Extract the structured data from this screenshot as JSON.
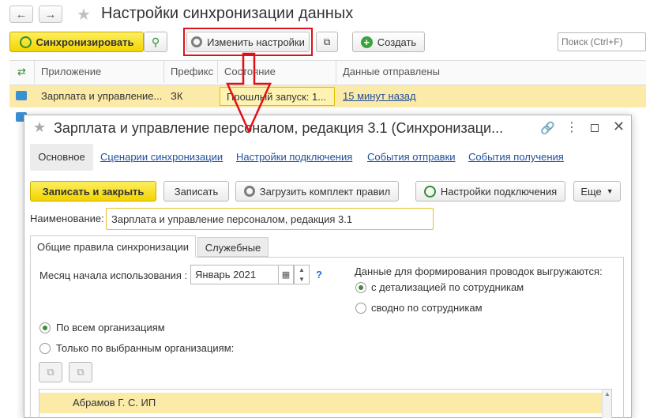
{
  "window": {
    "title": "Настройки синхронизации данных",
    "search_placeholder": "Поиск (Ctrl+F)"
  },
  "toolbar": {
    "sync_label": "Синхронизировать",
    "change_settings_label": "Изменить настройки",
    "create_label": "Создать"
  },
  "table": {
    "columns": [
      "Приложение",
      "Префикс",
      "Состояние",
      "Данные отправлены"
    ],
    "rows": [
      {
        "app": "Зарплата и управление...",
        "prefix": "ЗК",
        "state": "Прошлый запуск: 1...",
        "sent": "15 минут назад"
      }
    ]
  },
  "dialog": {
    "title": "Зарплата и управление персоналом, редакция 3.1 (Синхронизаци...",
    "nav_tabs": [
      "Основное",
      "Сценарии синхронизации",
      "Настройки подключения",
      "События отправки",
      "События получения"
    ],
    "buttons": {
      "save_close": "Записать и закрыть",
      "save": "Записать",
      "load_rules": "Загрузить комплект правил",
      "conn_settings": "Настройки подключения",
      "more": "Еще"
    },
    "name_label": "Наименование:",
    "name_value": "Зарплата и управление персоналом, редакция 3.1",
    "inner_tabs": [
      "Общие правила синхронизации",
      "Служебные"
    ],
    "month_label": "Месяц начала использования :",
    "month_value": "Январь 2021",
    "help": "?",
    "postings_label": "Данные для формирования проводок выгружаются:",
    "postings_options": [
      "с детализацией по сотрудникам",
      "сводно по сотрудникам"
    ],
    "org_options": [
      "По всем организациям",
      "Только по выбранным организациям:"
    ],
    "org_list": [
      "Абрамов Г. С. ИП"
    ]
  },
  "colors": {
    "accent_yellow": "#f5d800",
    "highlight_red": "#e0101a",
    "row_selected": "#fbeaa8",
    "link_blue": "#1f4e9c"
  }
}
